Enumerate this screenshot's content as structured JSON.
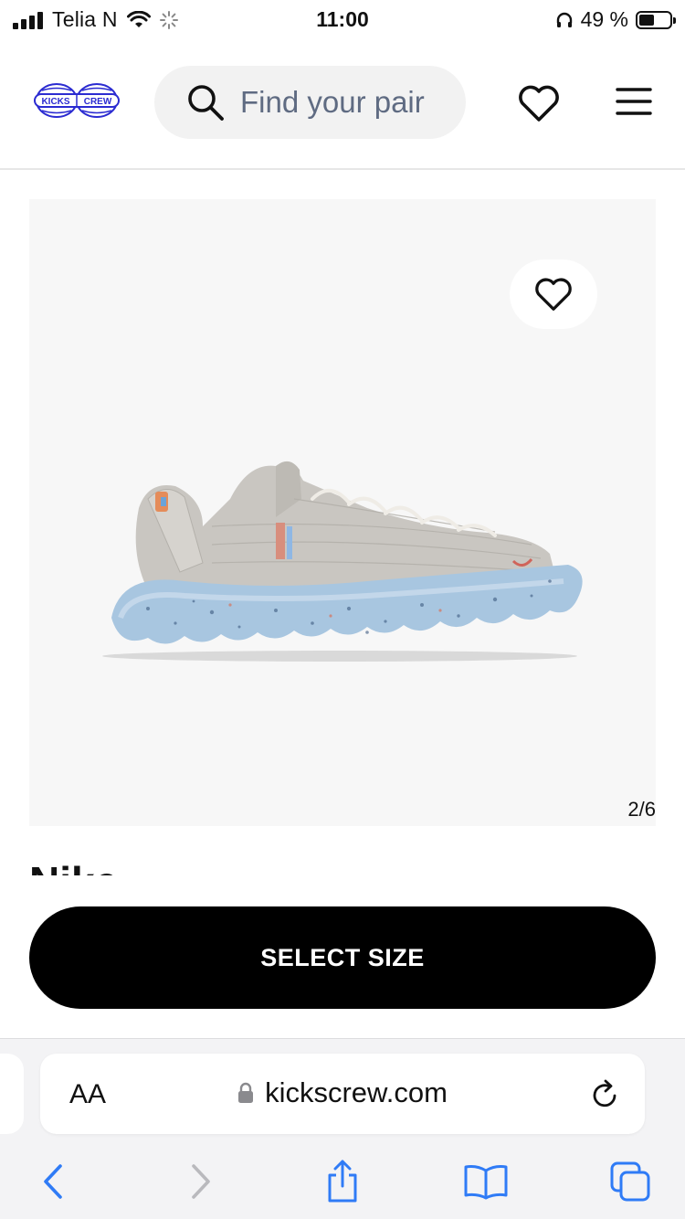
{
  "status_bar": {
    "carrier": "Telia N",
    "time": "11:00",
    "battery": "49 %",
    "battery_level": 0.49
  },
  "header": {
    "logo_text_left": "KICKS",
    "logo_text_right": "CREW",
    "search_placeholder": "Find your pair",
    "brand_color": "#2b2bd1"
  },
  "gallery": {
    "counter": "2/6",
    "current_index": 2,
    "total": 6
  },
  "product": {
    "brand": "Nike"
  },
  "cta": {
    "label": "SELECT SIZE"
  },
  "browser": {
    "text_size_label": "AA",
    "url": "kickscrew.com",
    "accent_color": "#2f7bf6"
  }
}
